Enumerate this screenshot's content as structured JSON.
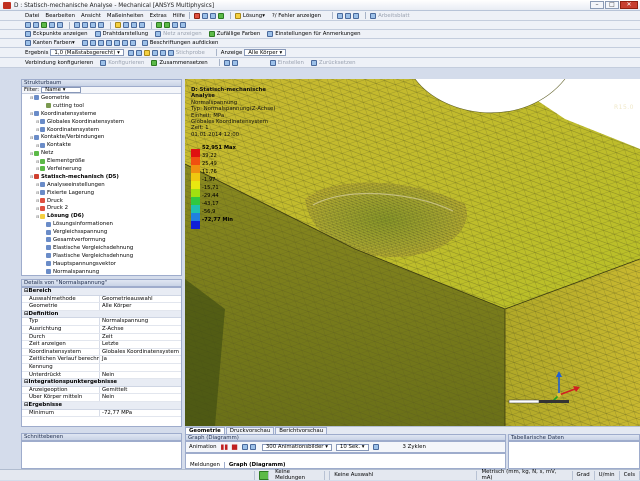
{
  "window": {
    "title": "D : Statisch-mechanische Analyse - Mechanical [ANSYS Multiphysics]"
  },
  "menu": [
    "Datei",
    "Bearbeiten",
    "Ansicht",
    "Maßeinheiten",
    "Extras",
    "Hilfe"
  ],
  "toolbar1": {
    "loesung": "Lösung",
    "fehler": "?/ Fehler anzeigen",
    "arbeitsblatt": "Arbeitsblatt"
  },
  "toolbar2": {
    "eckpunkte": "Eckpunkte anzeigen",
    "draht": "Drahtdarstellung",
    "netz": "Netz anzeigen",
    "zufall": "Zufällige Farben",
    "einst": "Einstellungen für Anmerkungen"
  },
  "toolbar3": {
    "kanten": "Kanten Farben",
    "beschriftungen": "Beschriftungen aufdicken"
  },
  "toolbar4": {
    "ergebnis_label": "Ergebnis",
    "ergebnis_val": "1,0 (Maßstabsgerecht)",
    "stichprobe": "Stichprobe",
    "anzeige_label": "Anzeige",
    "anzeige_val": "Alle Körper"
  },
  "toolbar5": {
    "verbindung": "Verbindung konfigurieren",
    "konfig": "Konfigurieren",
    "zusammen": "Zusammensetzen",
    "einstellen": "Einstellen",
    "zurueck": "Zurücksetzen"
  },
  "tree": {
    "header": "Strukturbaum",
    "filter_label": "Filter:",
    "filter_val": "Name",
    "items": [
      {
        "label": "Geometrie",
        "indent": 1,
        "bold": false,
        "color": "#6a8cc8"
      },
      {
        "label": "cutting tool",
        "indent": 3,
        "bold": false,
        "color": "#7a9a50"
      },
      {
        "label": "Koordinatensysteme",
        "indent": 1,
        "bold": false,
        "color": "#6a8cc8"
      },
      {
        "label": "Globales Koordinatensystem",
        "indent": 2,
        "bold": false,
        "color": "#6a8cc8"
      },
      {
        "label": "Koordinatensystem",
        "indent": 2,
        "bold": false,
        "color": "#6a8cc8"
      },
      {
        "label": "Kontakte/Verbindungen",
        "indent": 1,
        "bold": false,
        "color": "#6a8cc8"
      },
      {
        "label": "Kontakte",
        "indent": 2,
        "bold": false,
        "color": "#6a8cc8"
      },
      {
        "label": "Netz",
        "indent": 1,
        "bold": false,
        "color": "#5cba48"
      },
      {
        "label": "Elementgröße",
        "indent": 2,
        "bold": false,
        "color": "#5cba48"
      },
      {
        "label": "Verfeinerung",
        "indent": 2,
        "bold": false,
        "color": "#5cba48"
      },
      {
        "label": "Statisch-mechanisch (D5)",
        "indent": 1,
        "bold": true,
        "color": "#d04030"
      },
      {
        "label": "Analyseeinstellungen",
        "indent": 2,
        "bold": false,
        "color": "#6a8cc8"
      },
      {
        "label": "Fixierte Lagerung",
        "indent": 2,
        "bold": false,
        "color": "#6a8cc8"
      },
      {
        "label": "Druck",
        "indent": 2,
        "bold": false,
        "color": "#e05040"
      },
      {
        "label": "Druck 2",
        "indent": 2,
        "bold": false,
        "color": "#e05040"
      },
      {
        "label": "Lösung (D6)",
        "indent": 2,
        "bold": true,
        "color": "#f4d040"
      },
      {
        "label": "Lösungsinformationen",
        "indent": 3,
        "bold": false,
        "color": "#6a8cc8"
      },
      {
        "label": "Vergleichsspannung",
        "indent": 3,
        "bold": false,
        "color": "#6a8cc8"
      },
      {
        "label": "Gesamtverformung",
        "indent": 3,
        "bold": false,
        "color": "#6a8cc8"
      },
      {
        "label": "Elastische Vergleichsdehnung",
        "indent": 3,
        "bold": false,
        "color": "#6a8cc8"
      },
      {
        "label": "Plastische Vergleichsdehnung",
        "indent": 3,
        "bold": false,
        "color": "#6a8cc8"
      },
      {
        "label": "Hauptspannungsvektor",
        "indent": 3,
        "bold": false,
        "color": "#6a8cc8"
      },
      {
        "label": "Normalspannung",
        "indent": 3,
        "bold": false,
        "color": "#6a8cc8"
      }
    ]
  },
  "details": {
    "header": "Details von \"Normalspannung\"",
    "rows": [
      {
        "type": "sec",
        "k": "Bereich"
      },
      {
        "type": "row",
        "k": "Auswahlmethode",
        "v": "Geometrieauswahl"
      },
      {
        "type": "row",
        "k": "Geometrie",
        "v": "Alle Körper"
      },
      {
        "type": "sec",
        "k": "Definition"
      },
      {
        "type": "row",
        "k": "Typ",
        "v": "Normalspannung"
      },
      {
        "type": "row",
        "k": "Ausrichtung",
        "v": "Z-Achse"
      },
      {
        "type": "row",
        "k": "Durch",
        "v": "Zeit"
      },
      {
        "type": "row",
        "k": "Zeit anzeigen",
        "v": "Letzte"
      },
      {
        "type": "row",
        "k": "Koordinatensystem",
        "v": "Globales Koordinatensystem"
      },
      {
        "type": "row",
        "k": "Zeitlichen Verlauf berechnen",
        "v": "Ja"
      },
      {
        "type": "row",
        "k": "Kennung",
        "v": ""
      },
      {
        "type": "row",
        "k": "Unterdrückt",
        "v": "Nein"
      },
      {
        "type": "sec",
        "k": "Integrationspunktergebnisse"
      },
      {
        "type": "row",
        "k": "Anzeigeoption",
        "v": "Gemittelt"
      },
      {
        "type": "row",
        "k": "Über Körper mitteln",
        "v": "Nein"
      },
      {
        "type": "sec",
        "k": "Ergebnisse"
      },
      {
        "type": "row",
        "k": "Minimum",
        "v": "-72,77 MPa"
      }
    ]
  },
  "viewport": {
    "legend_title": "D: Statisch-mechanische Analyse",
    "legend_lines": [
      "Normalspannung",
      "Typ: Normalspannung(Z-Achse)",
      "Einheit: MPa",
      "Globales Koordinatensystem",
      "Zeit: 1",
      "01.01.2014 12:00"
    ],
    "legend_max": "52,951 Max",
    "legend_values": [
      "39,22",
      "25,49",
      "11,76",
      "-1,97",
      "-15,71",
      "-29,44",
      "-43,17",
      "-56,9"
    ],
    "legend_min": "-72,77 Min",
    "legend_colors": [
      "#e01010",
      "#f05010",
      "#f09010",
      "#f0c810",
      "#e8e810",
      "#a0e010",
      "#30c840",
      "#20c0b0",
      "#2080e0",
      "#1020d8"
    ],
    "brand": "ANSYS",
    "release": "R15.0"
  },
  "view_tabs": [
    "Geometrie",
    "Druckvorschau",
    "Berichtvorschau"
  ],
  "graph": {
    "header": "Graph (Diagramm)",
    "animation": "Animation",
    "bilder": "300 Animationsbilder",
    "sek": "10 Sek.",
    "zyklen": "3 Zyklen",
    "tab1": "Meldungen",
    "tab2": "Graph (Diagramm)"
  },
  "tabdata": {
    "header": "Tabellarische Daten"
  },
  "selinfo": {
    "header": "Schnittebenen"
  },
  "status": {
    "meldung": "Keine Meldungen",
    "auswahl": "Keine Auswahl",
    "einheiten": "Metrisch (mm, kg, N, s, mV, mA)",
    "grad": "Grad",
    "umin": "U/min",
    "cels": "Cels"
  }
}
